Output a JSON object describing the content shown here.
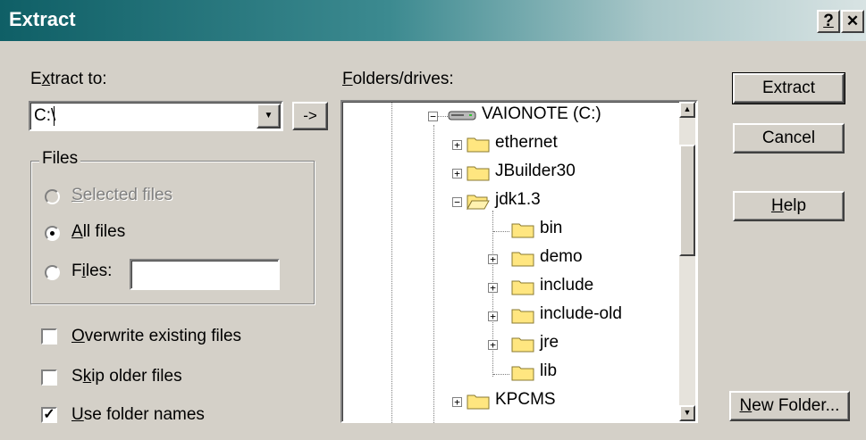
{
  "window": {
    "title": "Extract",
    "help_glyph": "?",
    "close_glyph": "✕"
  },
  "left": {
    "extract_to_label_pre": "E",
    "extract_to_label_ul": "x",
    "extract_to_label_post": "tract to:",
    "path_value": "C:\\",
    "arrow_button": "->",
    "files_group_title": "Files",
    "radio_selected_ul": "S",
    "radio_selected_post": "elected files",
    "radio_all_ul": "A",
    "radio_all_post": "ll files",
    "radio_files_pre": "F",
    "radio_files_ul": "i",
    "radio_files_post": "les:",
    "files_pattern_value": "",
    "overwrite_ul": "O",
    "overwrite_post": "verwrite existing files",
    "skip_pre": "S",
    "skip_ul": "k",
    "skip_post": "ip older files",
    "use_folder_ul": "U",
    "use_folder_post": "se folder names"
  },
  "checks": {
    "overwrite": false,
    "skip_older": false,
    "use_folder_names": true
  },
  "radios": {
    "selected": "all_files"
  },
  "tree": {
    "label_ul": "F",
    "label_post": "olders/drives:",
    "nodes": [
      {
        "label": "VAIONOTE (C:)",
        "icon": "drive-icon",
        "expander": "−"
      },
      {
        "label": "ethernet",
        "icon": "folder-icon",
        "expander": "+"
      },
      {
        "label": "JBuilder30",
        "icon": "folder-icon",
        "expander": "+"
      },
      {
        "label": "jdk1.3",
        "icon": "folder-open-icon",
        "expander": "−"
      },
      {
        "label": "bin",
        "icon": "folder-icon",
        "expander": ""
      },
      {
        "label": "demo",
        "icon": "folder-icon",
        "expander": "+"
      },
      {
        "label": "include",
        "icon": "folder-icon",
        "expander": "+"
      },
      {
        "label": "include-old",
        "icon": "folder-icon",
        "expander": "+"
      },
      {
        "label": "jre",
        "icon": "folder-icon",
        "expander": "+"
      },
      {
        "label": "lib",
        "icon": "folder-icon",
        "expander": ""
      },
      {
        "label": "KPCMS",
        "icon": "folder-icon",
        "expander": "+"
      }
    ]
  },
  "buttons": {
    "extract": "Extract",
    "cancel": "Cancel",
    "help_ul": "H",
    "help_post": "elp",
    "new_folder_ul": "N",
    "new_folder_post": "ew Folder..."
  },
  "colors": {
    "title_start": "#0f5f66",
    "face": "#d4d0c8",
    "folder": "#ffe680"
  }
}
